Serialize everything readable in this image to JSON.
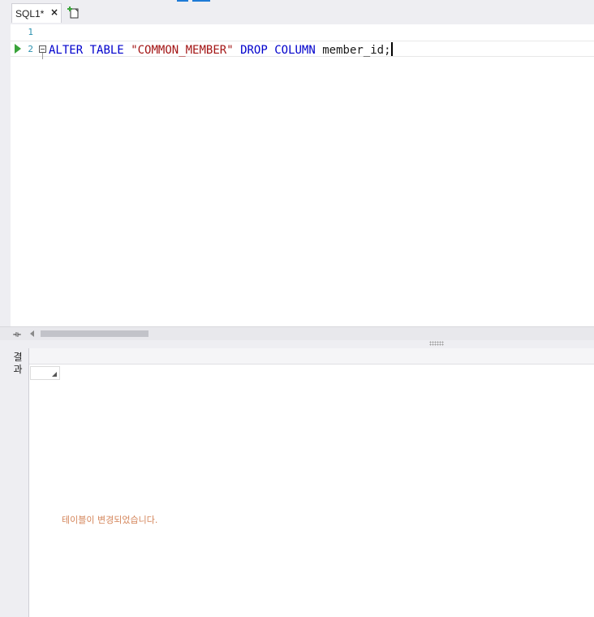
{
  "tabs": [
    {
      "label": "SQL1*",
      "close": "×"
    }
  ],
  "editor": {
    "line_numbers": [
      "1",
      "2"
    ],
    "line2": {
      "kw1": "ALTER",
      "kw2": "TABLE",
      "string": "\"COMMON_MEMBER\"",
      "kw3": "DROP",
      "kw4": "COLUMN",
      "ident": "member_id;"
    }
  },
  "result": {
    "tab_label": "결과",
    "message": "테이블이 변경되었습니다."
  },
  "colors": {
    "keyword": "#0000cc",
    "string": "#a31515",
    "line_number": "#2b91af",
    "message": "#d4855a",
    "run_arrow": "#3aa33a"
  },
  "icons": [
    "close-icon",
    "new-tab-icon",
    "run-arrow-icon",
    "fold-icon",
    "split-icon",
    "scroll-left-icon"
  ]
}
